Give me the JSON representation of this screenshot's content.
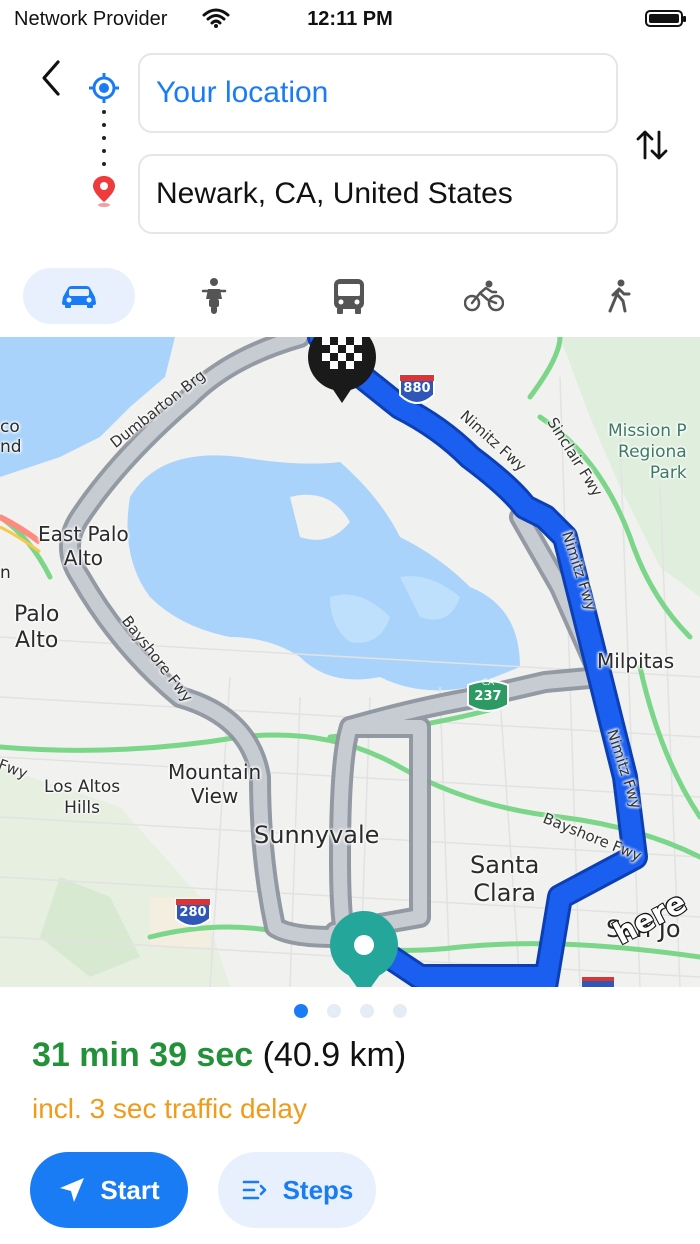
{
  "status_bar": {
    "carrier": "Network Provider",
    "time": "12:11 PM"
  },
  "route": {
    "origin": "Your location",
    "destination": "Newark, CA, United States"
  },
  "modes": [
    {
      "name": "car",
      "active": true
    },
    {
      "name": "scooter",
      "active": false
    },
    {
      "name": "bus",
      "active": false
    },
    {
      "name": "bicycle",
      "active": false
    },
    {
      "name": "walk",
      "active": false
    }
  ],
  "map": {
    "labels": {
      "dumbarton": "Dumbarton Brg",
      "east_palo_alto": "East Palo\nAlto",
      "palo_alto": "Palo\nAlto",
      "bayshore1": "Bayshore Fwy",
      "mountain_view": "Mountain\nView",
      "los_altos_hills": "Los Altos\nHills",
      "sunnyvale": "Sunnyvale",
      "santa_clara": "Santa\nClara",
      "milpitas": "Milpitas",
      "mission_peak": "Mission P\nRegiona\nPark",
      "nimitz1": "Nimitz Fwy",
      "nimitz2": "Nimitz Fwy",
      "nimitz3": "Nimitz Fwy",
      "sinclair": "Sinclair Fwy",
      "bayshore2": "Bayshore Fwy",
      "san_jose": "San Jo",
      "fwy_left": "Fwy",
      "co_nd": "co\nnd",
      "left_n": "n",
      "shield_880": "880",
      "shield_237_top": "CA",
      "shield_237": "237",
      "shield_280": "280",
      "attribution": "here"
    }
  },
  "pager": {
    "count": 4,
    "active": 0
  },
  "summary": {
    "duration": "31 min 39 sec",
    "distance": "(40.9 km)",
    "traffic": "incl. 3 sec traffic delay"
  },
  "buttons": {
    "start": "Start",
    "steps": "Steps"
  },
  "colors": {
    "accent": "#1a7cf5",
    "route_primary": "#1a5ff0",
    "route_alt": "#a9afb8",
    "duration": "#23913a",
    "traffic": "#f29a1a",
    "water": "#a9d3fb",
    "pin_start": "#24a79a"
  }
}
